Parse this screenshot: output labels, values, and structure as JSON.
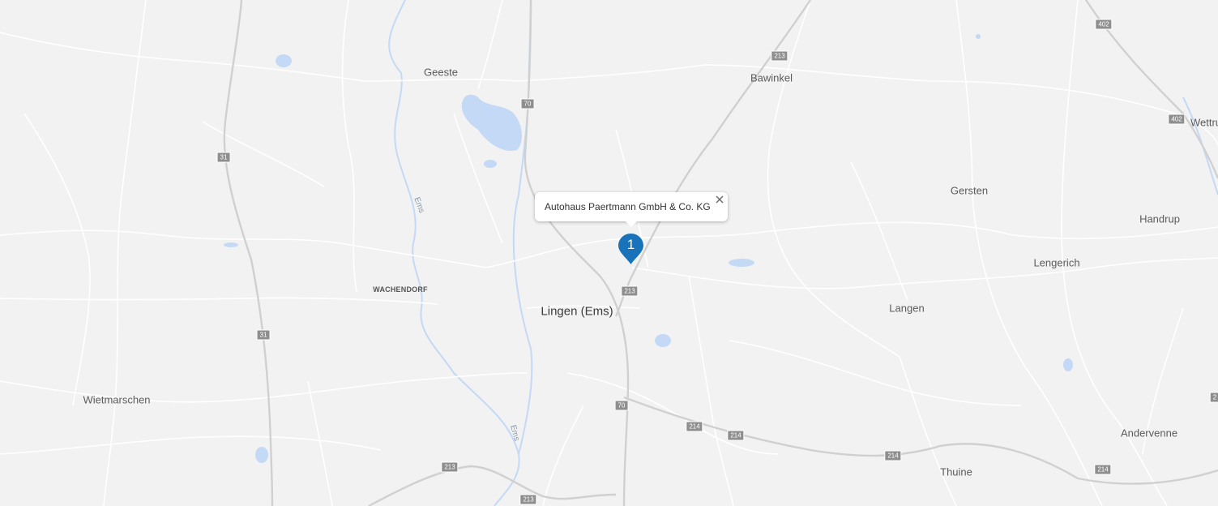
{
  "map": {
    "places": [
      {
        "name": "Geeste",
        "kind": "town"
      },
      {
        "name": "Bawinkel",
        "kind": "town"
      },
      {
        "name": "Gersten",
        "kind": "town"
      },
      {
        "name": "Handrup",
        "kind": "town"
      },
      {
        "name": "Lengerich",
        "kind": "town"
      },
      {
        "name": "Langen",
        "kind": "town"
      },
      {
        "name": "Lingen (Ems)",
        "kind": "city"
      },
      {
        "name": "WACHENDORF",
        "kind": "small"
      },
      {
        "name": "Wietmarschen",
        "kind": "town"
      },
      {
        "name": "Andervenne",
        "kind": "town"
      },
      {
        "name": "Thuine",
        "kind": "town"
      },
      {
        "name": "Wettru",
        "kind": "town"
      },
      {
        "name": "Ems",
        "kind": "river"
      },
      {
        "name": "Ems",
        "kind": "river"
      }
    ],
    "road_shields": [
      "402",
      "402",
      "213",
      "70",
      "31",
      "31",
      "213",
      "70",
      "214",
      "214",
      "214",
      "214",
      "213",
      "213",
      "2"
    ]
  },
  "marker": {
    "label": "1",
    "color": "#1a73b8"
  },
  "popup": {
    "title": "Autohaus Paertmann GmbH & Co. KG"
  },
  "colors": {
    "land": "#f2f2f2",
    "road": "#ffffff",
    "highway": "#d0d0d0",
    "water": "#c4d9f5",
    "shield": "#8e8e8e"
  }
}
